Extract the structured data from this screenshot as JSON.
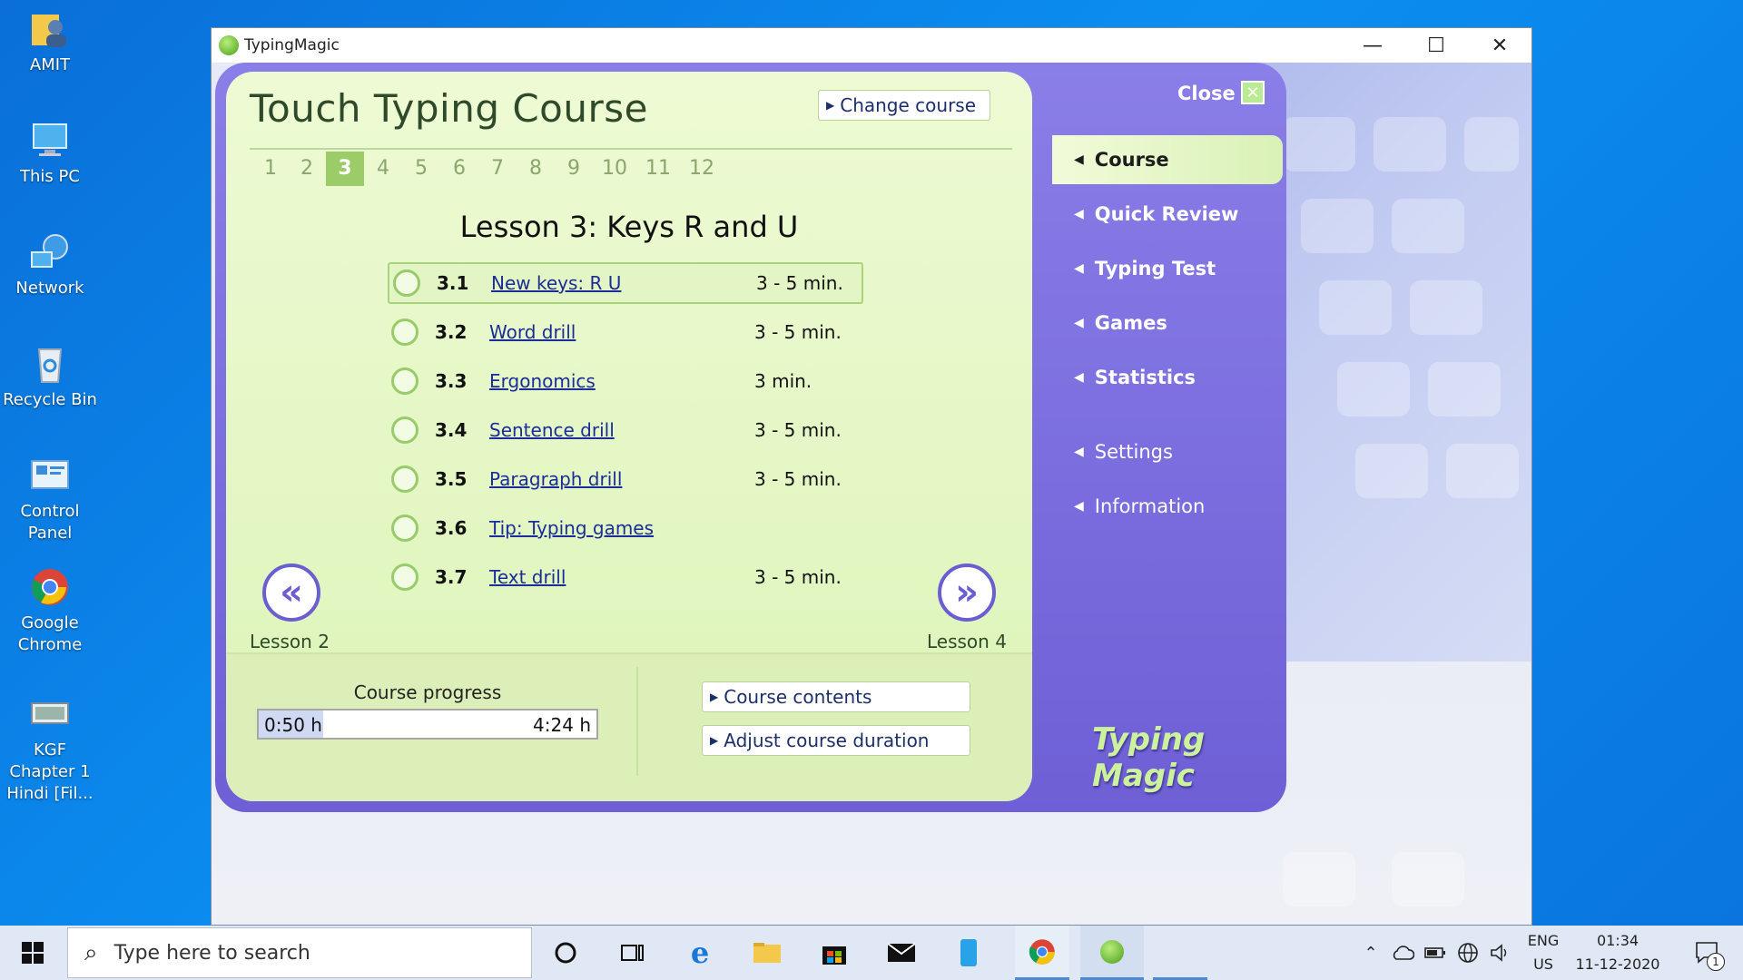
{
  "desktop": {
    "icons": [
      {
        "label": "AMIT"
      },
      {
        "label": "This PC"
      },
      {
        "label": "Network"
      },
      {
        "label": "Recycle Bin"
      },
      {
        "label": "Control Panel"
      },
      {
        "label": "Google Chrome"
      },
      {
        "label": "KGF Chapter 1 Hindi [Fil..."
      }
    ]
  },
  "window": {
    "title": "TypingMagic",
    "controls": {
      "minimize": "—",
      "maximize": "☐",
      "close": "✕"
    }
  },
  "course": {
    "title": "Touch Typing Course",
    "change_course": "Change course",
    "lesson_tabs": [
      "1",
      "2",
      "3",
      "4",
      "5",
      "6",
      "7",
      "8",
      "9",
      "10",
      "11",
      "12"
    ],
    "active_lesson": "3",
    "lesson_heading": "Lesson 3: Keys R and U",
    "exercises": [
      {
        "num": "3.1",
        "name": "New keys: R U",
        "duration": "3 - 5 min."
      },
      {
        "num": "3.2",
        "name": "Word drill",
        "duration": "3 - 5 min."
      },
      {
        "num": "3.3",
        "name": "Ergonomics",
        "duration": "3 min."
      },
      {
        "num": "3.4",
        "name": "Sentence drill",
        "duration": "3 - 5 min."
      },
      {
        "num": "3.5",
        "name": "Paragraph drill",
        "duration": "3 - 5 min."
      },
      {
        "num": "3.6",
        "name": "Tip: Typing games",
        "duration": ""
      },
      {
        "num": "3.7",
        "name": "Text drill",
        "duration": "3 - 5 min."
      }
    ],
    "prev_label": "Lesson 2",
    "next_label": "Lesson 4",
    "progress": {
      "label": "Course progress",
      "done": "0:50 h",
      "total": "4:24 h",
      "fraction": 0.19
    },
    "course_contents": "Course contents",
    "adjust_duration": "Adjust course duration"
  },
  "menu": {
    "close": "Close",
    "items": [
      {
        "label": "Course"
      },
      {
        "label": "Quick Review"
      },
      {
        "label": "Typing Test"
      },
      {
        "label": "Games"
      },
      {
        "label": "Statistics"
      },
      {
        "label": "Settings"
      },
      {
        "label": "Information"
      }
    ],
    "brand": "Typing Magic"
  },
  "taskbar": {
    "search_placeholder": "Type here to search",
    "lang_top": "ENG",
    "lang_bottom": "US",
    "time": "01:34",
    "date": "11-12-2020",
    "notification_count": "1"
  },
  "colors": {
    "accent_green": "#9ccc68",
    "menu_purple": "#6e5fd6",
    "link_blue": "#1a2d98"
  }
}
